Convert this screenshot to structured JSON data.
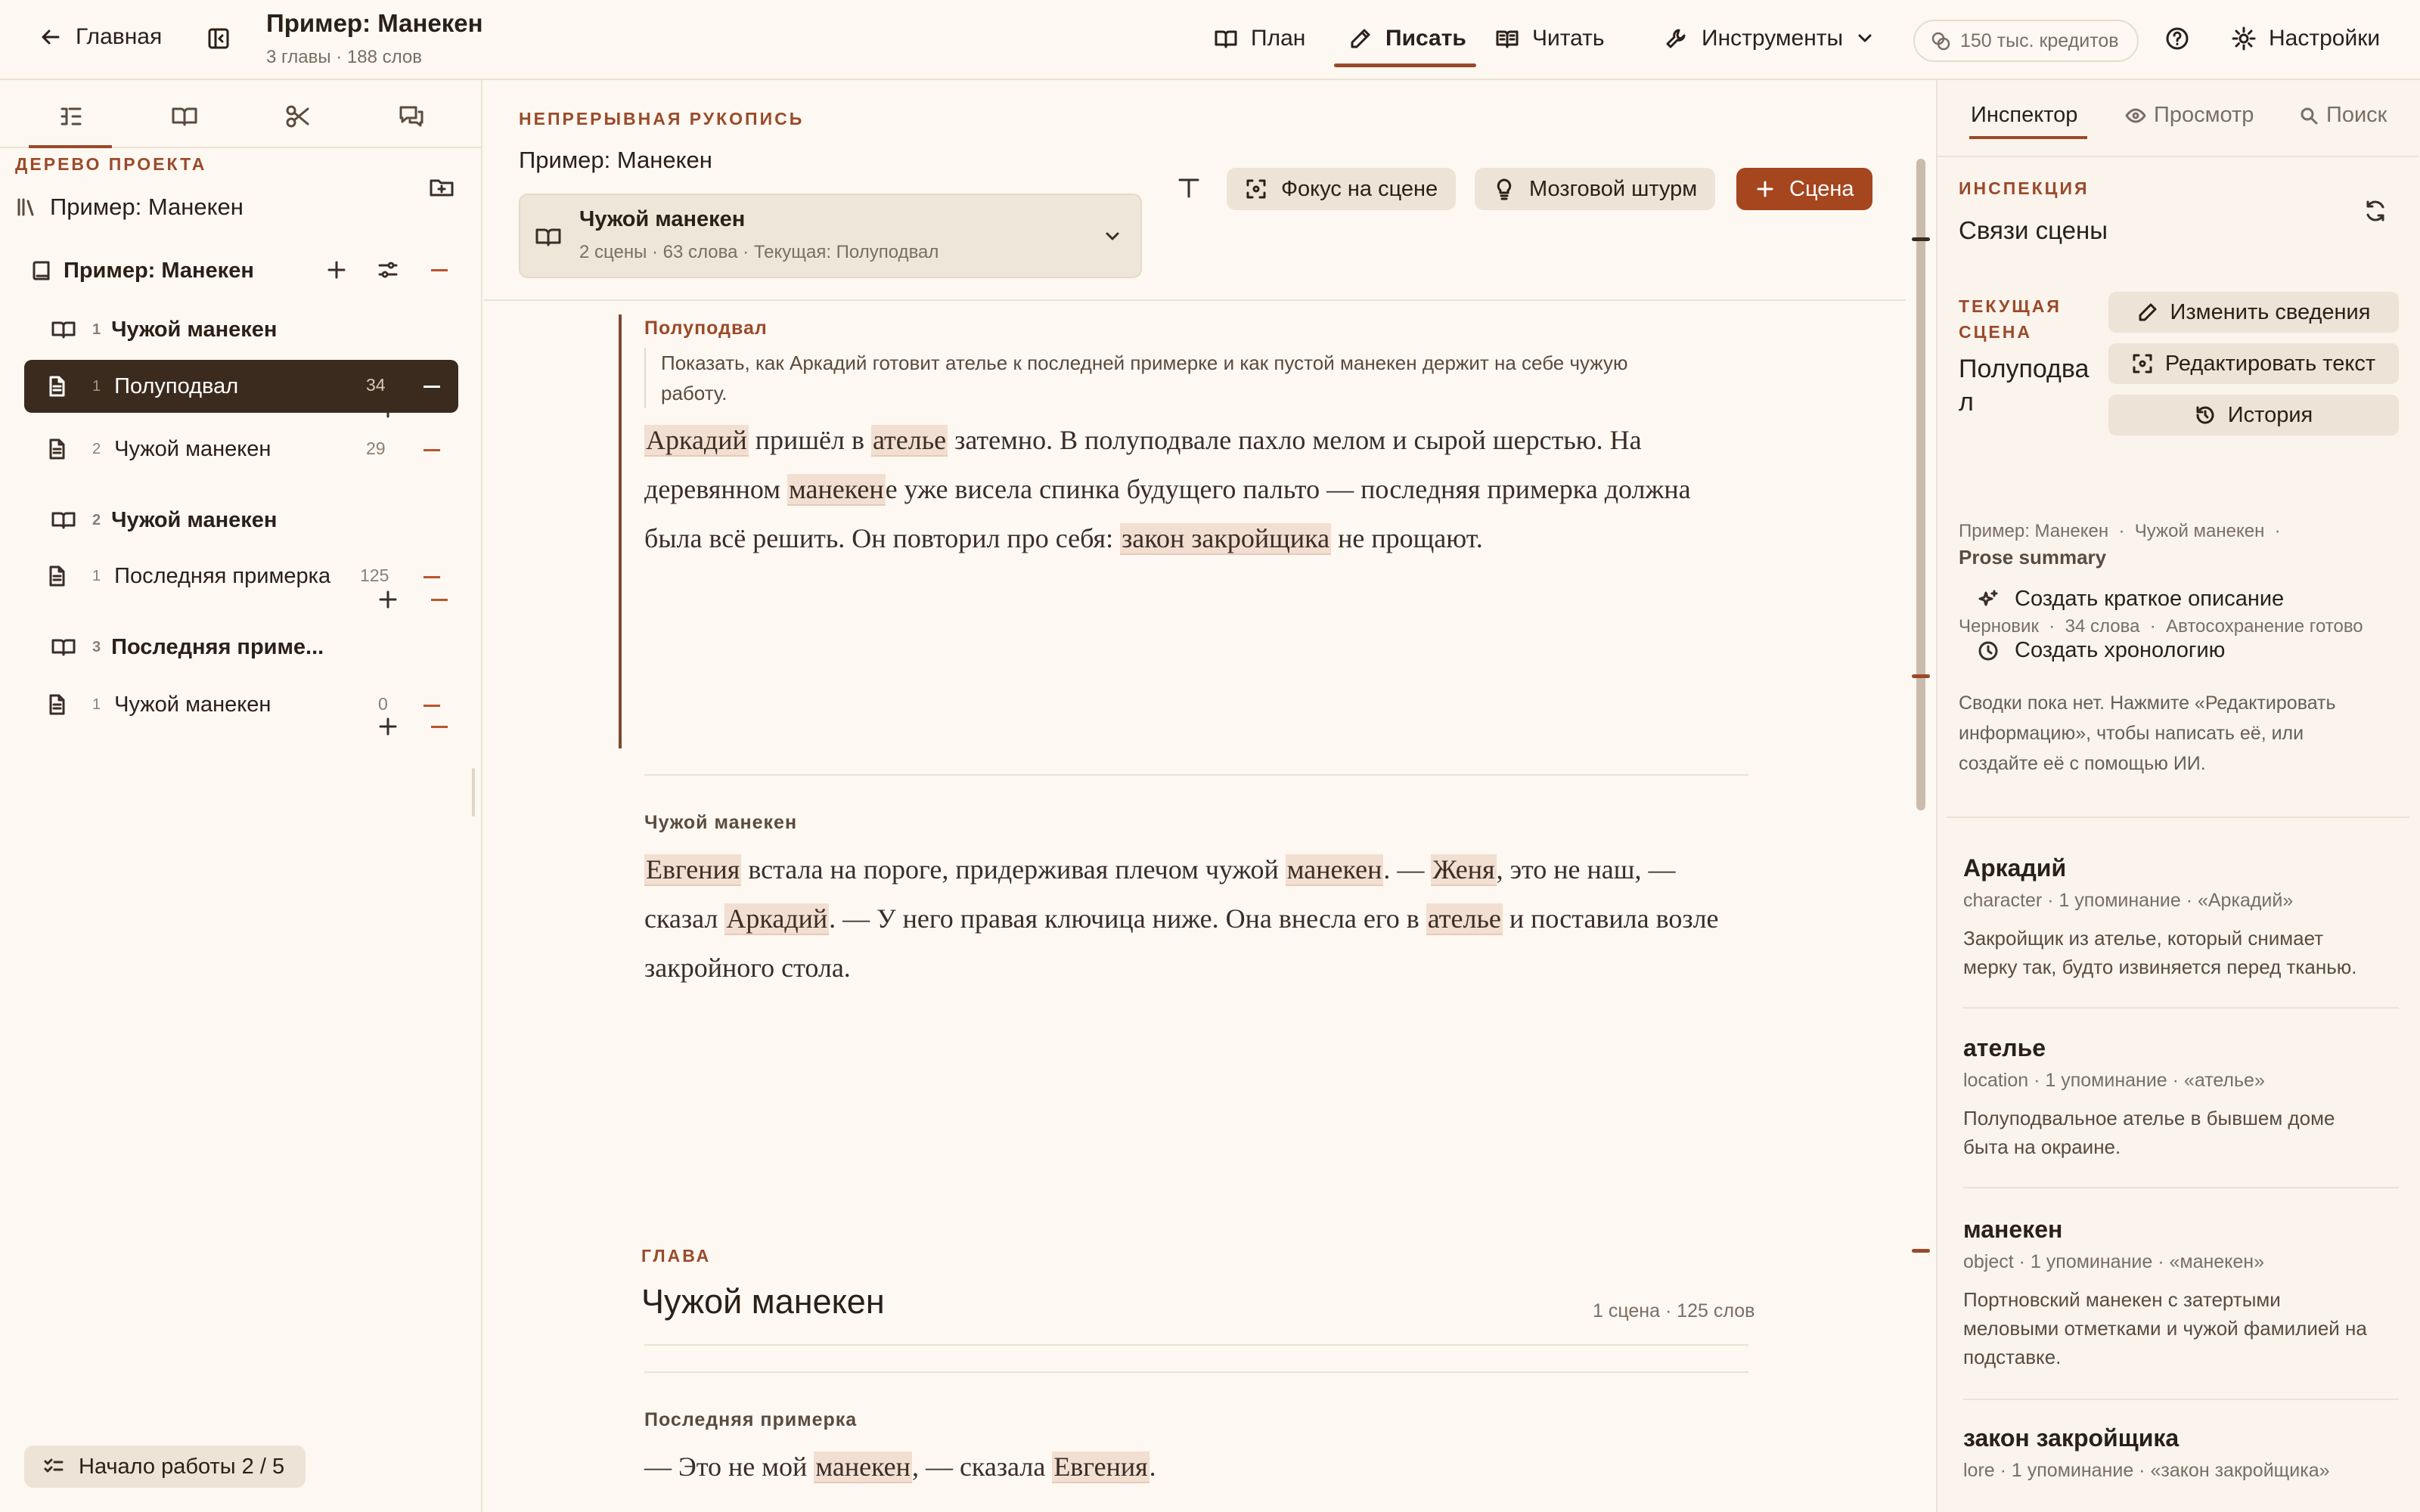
{
  "header": {
    "home": "Главная",
    "project_title": "Пример: Манекен",
    "project_sub": "3 главы · 188 слов",
    "tabs": {
      "plan": "План",
      "write": "Писать",
      "read": "Читать"
    },
    "tools": "Инструменты",
    "credits": "150 тыс. кредитов",
    "settings": "Настройки"
  },
  "sidebar": {
    "tree_label": "ДЕРЕВО ПРОЕКТА",
    "library": "Пример: Манекен",
    "book": "Пример: Манекен",
    "chapters": [
      {
        "num": "1",
        "title": "Чужой манекен",
        "scenes": [
          {
            "num": "1",
            "title": "Полуподвал",
            "count": "34"
          },
          {
            "num": "2",
            "title": "Чужой манекен",
            "count": "29"
          }
        ]
      },
      {
        "num": "2",
        "title": "Чужой манекен",
        "scenes": [
          {
            "num": "1",
            "title": "Последняя примерка",
            "count": "125"
          }
        ]
      },
      {
        "num": "3",
        "title": "Последняя приме...",
        "scenes": [
          {
            "num": "1",
            "title": "Чужой манекен",
            "count": "0"
          }
        ]
      }
    ],
    "start": "Начало работы 2 / 5"
  },
  "editor": {
    "label": "НЕПРЕРЫВНАЯ РУКОПИСЬ",
    "project": "Пример: Манекен",
    "chapter_title": "Чужой манекен",
    "chapter_meta": "2 сцены · 63 слова · Текущая: Полуподвал",
    "focus_btn": "Фокус на сцене",
    "brainstorm_btn": "Мозговой штурм",
    "scene_btn": "Сцена",
    "scene1": {
      "label": "Полуподвал",
      "summary1": "Показать, как Аркадий готовит ателье к последней примерке и как пустой манекен держит на себе чужую",
      "summary2": "работу.",
      "p1": {
        "h1": "Аркадий",
        "t1": " пришёл в ",
        "h2": "ателье",
        "t2": " затемно. В полуподвале пахло мелом и сырой шерстью. На"
      },
      "p2": {
        "t0": "деревянном ",
        "h1": "манекен",
        "t1": "е уже висела спинка будущего пальто — последняя примерка должна"
      },
      "p3": {
        "t0": "была всё решить. Он повторил про себя: ",
        "h1": "закон закройщика",
        "t1": " не прощают."
      }
    },
    "scene2": {
      "label": "Чужой манекен",
      "p1": {
        "h1": "Евгения",
        "t1": " встала на пороге, придерживая плечом чужой ",
        "h2": "манекен",
        "t2": ". — ",
        "h3": "Женя",
        "t3": ", это не наш, —"
      },
      "p2": {
        "t0": "сказал ",
        "h1": "Аркадий",
        "t1": ". — У него правая ключица ниже. Она внесла его в ",
        "h2": "ателье",
        "t2": " и поставила возле"
      },
      "p3": {
        "t0": "закройного стола."
      }
    },
    "chapter2": {
      "label": "ГЛАВА",
      "title": "Чужой манекен",
      "meta": "1 сцена · 125 слов",
      "scene_label": "Последняя примерка",
      "p1": {
        "t0": "— Это не мой ",
        "h1": "манекен",
        "t1": ", — сказала ",
        "h2": "Евгения",
        "t2": "."
      }
    }
  },
  "inspector": {
    "tabs": {
      "inspector": "Инспектор",
      "preview": "Просмотр",
      "search": "Поиск"
    },
    "label": "ИНСПЕКЦИЯ",
    "title": "Связи сцены",
    "current_label_1": "ТЕКУЩАЯ",
    "current_label_2": "СЦЕНА",
    "current_scene_1": "Полуподва",
    "current_scene_2": "л",
    "btn_edit_info": "Изменить сведения",
    "btn_edit_text": "Редактировать текст",
    "btn_history": "История",
    "meta_line1": "Пример: Манекен  ·  Чужой манекен  ·",
    "meta_line2": "Черновик  ·  34 слова  ·  Автосохранение готово",
    "prose_summary": "Prose summary",
    "create_summary": "Создать краткое описание",
    "create_chronology": "Создать хронологию",
    "no_summary_1": "Сводки пока нет. Нажмите «Редактировать",
    "no_summary_2": "информацию», чтобы написать её, или",
    "no_summary_3": "создайте её с помощью ИИ.",
    "entities": [
      {
        "name": "Аркадий",
        "meta": "character · 1 упоминание · «Аркадий»",
        "desc1": "Закройщик из ателье, который снимает",
        "desc2": "мерку так, будто извиняется перед тканью.",
        "desc3": ""
      },
      {
        "name": "ателье",
        "meta": "location · 1 упоминание · «ателье»",
        "desc1": "Полуподвальное ателье в бывшем доме",
        "desc2": "быта на окраине.",
        "desc3": ""
      },
      {
        "name": "манекен",
        "meta": "object · 1 упоминание · «манекен»",
        "desc1": "Портновский манекен с затертыми",
        "desc2": "меловыми отметками и чужой фамилией на",
        "desc3": "подставке."
      },
      {
        "name": "закон закройщика",
        "meta": "lore · 1 упоминание · «закон закройщика»",
        "desc1": "",
        "desc2": "",
        "desc3": ""
      }
    ]
  },
  "colors": {
    "accent": "#9a4a2a",
    "scene_button": "#a5461f",
    "active_row": "#3b2a1e",
    "highlight": "#f2dfd2"
  }
}
